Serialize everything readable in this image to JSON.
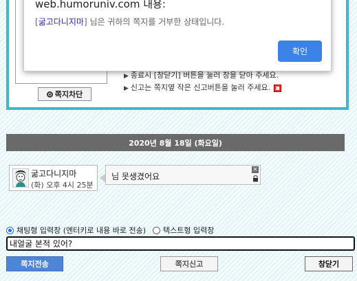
{
  "dialog": {
    "title": "web.humoruniv.com 내용:",
    "message_name": "굶고다니지마",
    "message_rest": " 님은 귀하의 쪽지를 거부한 상태입니다.",
    "ok_label": "확인"
  },
  "panel": {
    "block_button": "쪽지차단",
    "note1": "종료시 [창닫기] 버튼을 눌러 창을 닫아 주세요.",
    "note2": "신고는 쪽지옆 작은 신고버튼을 눌러 주세요."
  },
  "date_bar": "2020년 8월 18일 (화요일)",
  "message": {
    "sender_name": "굶고다니지마",
    "sender_time": "(화) 오후 4시 25분",
    "text": "님 못생겼어요",
    "close_glyph": "×"
  },
  "input": {
    "mode_chat": "채팅형 입력창 (엔터키로 내용 바로 전송)",
    "mode_text": "텍스트형 입력창",
    "value": "내얼굴 본적 있어?"
  },
  "buttons": {
    "send": "쪽지전송",
    "report": "쪽지신고",
    "close": "창닫기"
  },
  "colors": {
    "panel_border": "#40b8cc",
    "ok_button": "#3b82e6",
    "send_button": "#4d86d6",
    "date_bar": "#6a6a6a"
  }
}
